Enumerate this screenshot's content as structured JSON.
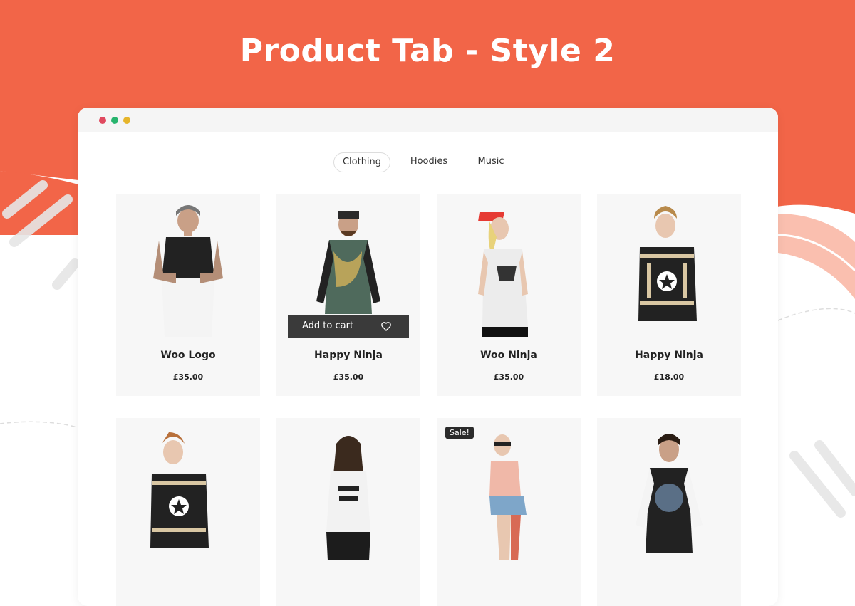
{
  "headline": "Product Tab - Style 2",
  "colors": {
    "brand": "#f26548",
    "window_bar": "#f5f5f5",
    "card_bg": "#f7f7f7",
    "dark_button": "#3a3a3a"
  },
  "window": {
    "controls": [
      "close-dot",
      "minimize-dot",
      "maximize-dot"
    ]
  },
  "tabs": [
    {
      "label": "Clothing",
      "active": true
    },
    {
      "label": "Hoodies",
      "active": false
    },
    {
      "label": "Music",
      "active": false
    }
  ],
  "products": [
    {
      "name": "Woo Logo",
      "price": "£35.00"
    },
    {
      "name": "Happy Ninja",
      "price": "£35.00",
      "add_to_cart": "Add to cart",
      "wishlist_icon": "heart-icon"
    },
    {
      "name": "Woo Ninja",
      "price": "£35.00"
    },
    {
      "name": "Happy Ninja",
      "price": "£18.00"
    },
    {
      "name": "",
      "price": ""
    },
    {
      "name": "",
      "price": ""
    },
    {
      "name": "",
      "price": "",
      "badge": "Sale!"
    },
    {
      "name": "",
      "price": ""
    }
  ]
}
